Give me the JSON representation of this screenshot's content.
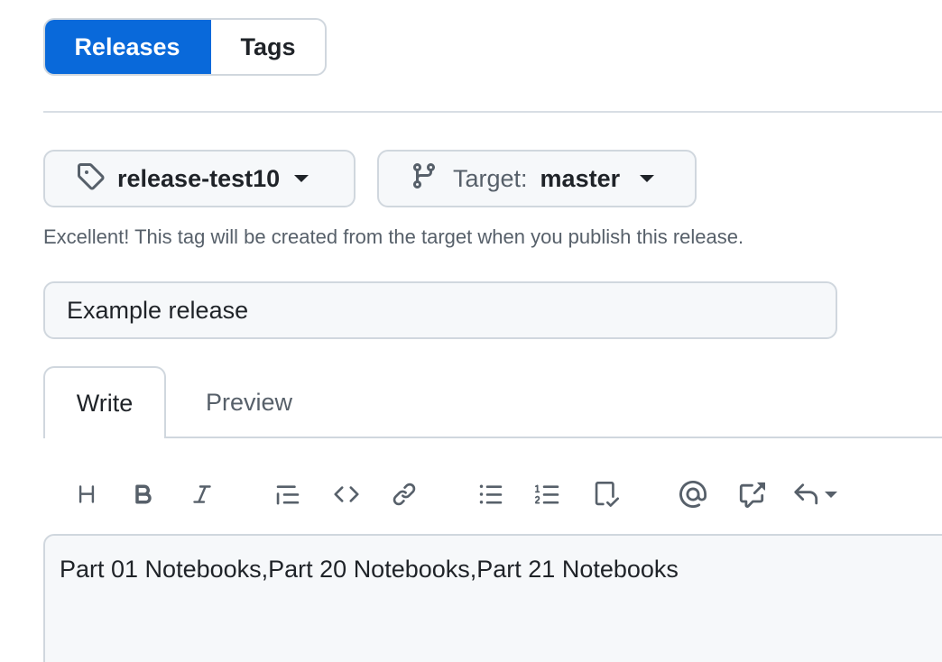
{
  "segmented": {
    "releases_label": "Releases",
    "tags_label": "Tags"
  },
  "tag_select": {
    "label": "release-test10"
  },
  "target_select": {
    "prefix": "Target:",
    "branch": "master"
  },
  "hint": "Excellent! This tag will be created from the target when you publish this release.",
  "title_input": {
    "value": "Example release"
  },
  "tabs": {
    "write": "Write",
    "preview": "Preview"
  },
  "toolbar": {
    "heading_icon": "heading-icon",
    "bold_icon": "bold-icon",
    "italic_icon": "italic-icon",
    "quote_icon": "quote-icon",
    "code_icon": "code-icon",
    "link_icon": "link-icon",
    "unordered_list_icon": "unordered-list-icon",
    "ordered_list_icon": "ordered-list-icon",
    "task_list_icon": "task-list-icon",
    "mention_icon": "mention-icon",
    "cross_reference_icon": "cross-reference-icon",
    "reply_icon": "reply-icon"
  },
  "editor": {
    "content": "Part 01 Notebooks,Part 20 Notebooks,Part 21 Notebooks"
  },
  "colors": {
    "accent": "#0969da",
    "border": "#d0d7de",
    "muted_text": "#57606a",
    "input_bg": "#f6f8fa"
  }
}
